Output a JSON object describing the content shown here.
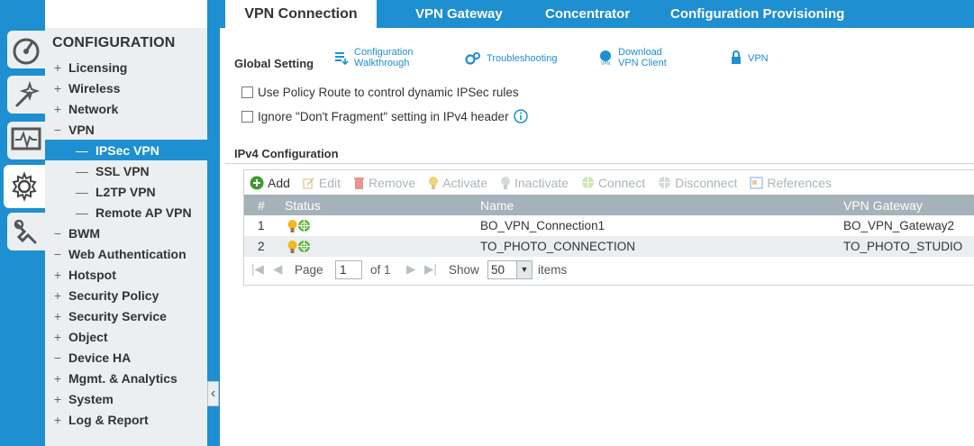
{
  "tabs": [
    {
      "label": "VPN Connection",
      "active": true
    },
    {
      "label": "VPN Gateway",
      "active": false
    },
    {
      "label": "Concentrator",
      "active": false
    },
    {
      "label": "Configuration Provisioning",
      "active": false
    }
  ],
  "sidebar": {
    "title": "CONFIGURATION",
    "icons": [
      "speedometer-icon",
      "wand-icon",
      "monitor-icon",
      "gear-icon",
      "tools-icon"
    ],
    "items": [
      {
        "sign": "+",
        "label": "Licensing"
      },
      {
        "sign": "+",
        "label": "Wireless"
      },
      {
        "sign": "+",
        "label": "Network"
      },
      {
        "sign": "−",
        "label": "VPN"
      },
      {
        "child": true,
        "label": "IPSec VPN",
        "selected": true
      },
      {
        "child": true,
        "label": "SSL VPN"
      },
      {
        "child": true,
        "label": "L2TP VPN"
      },
      {
        "child": true,
        "label": "Remote AP VPN"
      },
      {
        "sign": "−",
        "label": "BWM"
      },
      {
        "sign": "−",
        "label": "Web Authentication"
      },
      {
        "sign": "+",
        "label": "Hotspot"
      },
      {
        "sign": "+",
        "label": "Security Policy"
      },
      {
        "sign": "+",
        "label": "Security Service"
      },
      {
        "sign": "+",
        "label": "Object"
      },
      {
        "sign": "−",
        "label": "Device HA"
      },
      {
        "sign": "+",
        "label": "Mgmt. & Analytics"
      },
      {
        "sign": "+",
        "label": "System"
      },
      {
        "sign": "+",
        "label": "Log & Report"
      }
    ]
  },
  "global_setting": {
    "title": "Global Setting",
    "tools": {
      "walkthrough_line1": "Configuration",
      "walkthrough_line2": "Walkthrough",
      "troubleshooting": "Troubleshooting",
      "download_line1": "Download",
      "download_line2": "VPN Client",
      "vpn": "VPN"
    },
    "checkboxes": [
      {
        "label": "Use Policy Route to control dynamic IPSec rules",
        "checked": false
      },
      {
        "label": "Ignore \"Don't Fragment\" setting in IPv4 header",
        "checked": false
      }
    ]
  },
  "ipv4": {
    "title": "IPv4 Configuration",
    "toolbar": {
      "add": "Add",
      "edit": "Edit",
      "remove": "Remove",
      "activate": "Activate",
      "inactivate": "Inactivate",
      "connect": "Connect",
      "disconnect": "Disconnect",
      "references": "References"
    },
    "columns": {
      "num": "#",
      "status": "Status",
      "name": "Name",
      "gateway": "VPN Gateway"
    },
    "rows": [
      {
        "num": "1",
        "name": "BO_VPN_Connection1",
        "gateway": "BO_VPN_Gateway2"
      },
      {
        "num": "2",
        "name": "TO_PHOTO_CONNECTION",
        "gateway": "TO_PHOTO_STUDIO"
      }
    ],
    "pager": {
      "page_label": "Page",
      "page_value": "1",
      "of_label": "of 1",
      "show_label": "Show",
      "show_value": "50",
      "items_label": "items"
    }
  },
  "colors": {
    "accent": "#1e8fd0",
    "header_gray": "#a6b2b9",
    "panel_bg": "#eceff1"
  }
}
